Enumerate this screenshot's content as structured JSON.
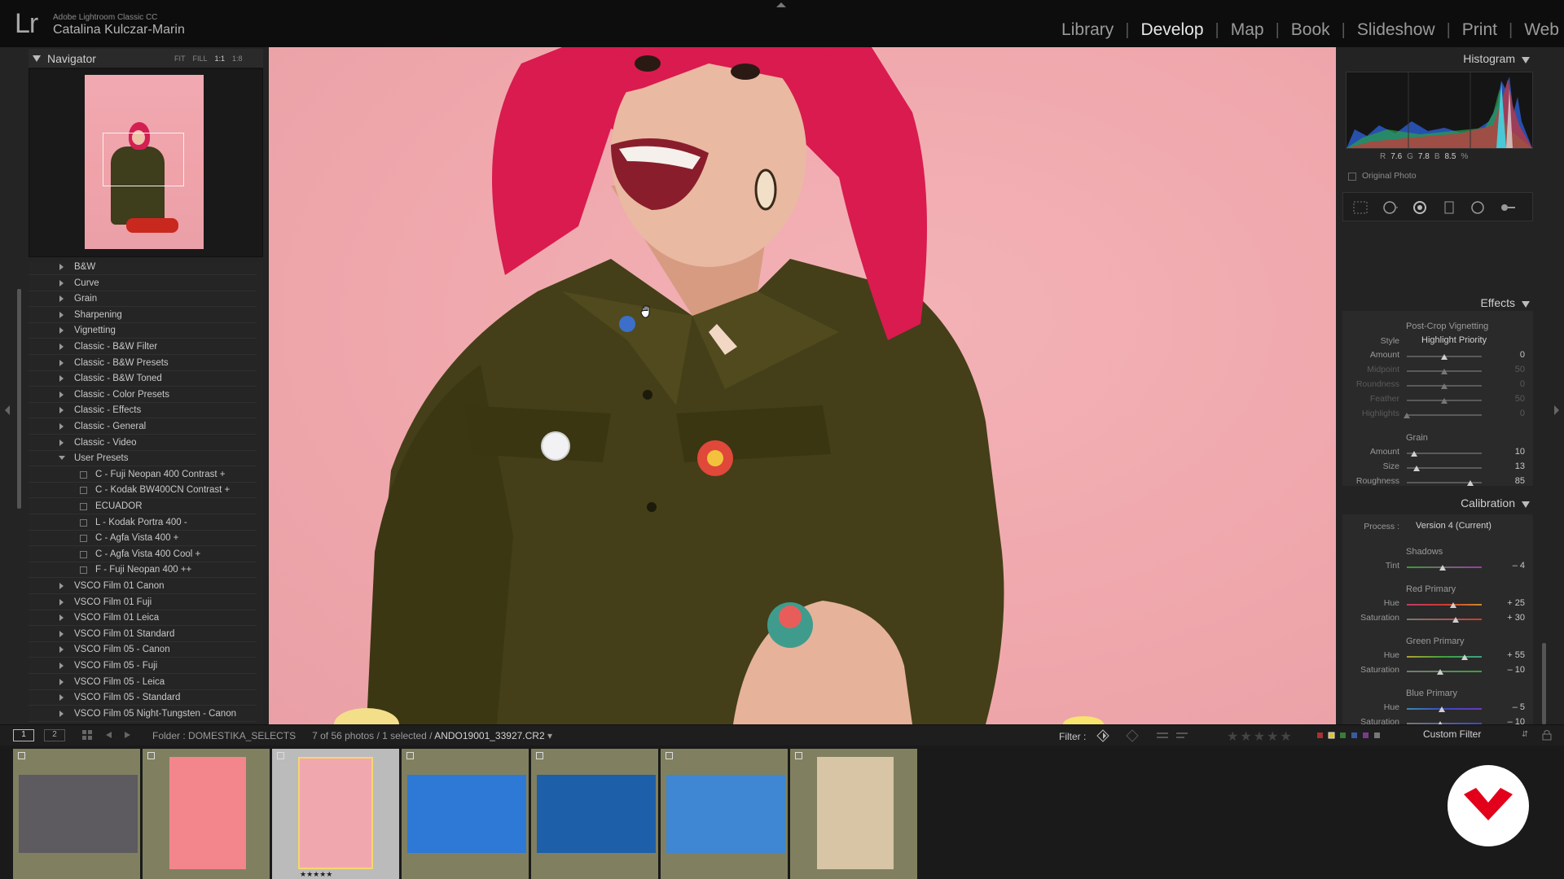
{
  "app": {
    "logo": "Lr",
    "name": "Adobe Lightroom Classic CC",
    "user": "Catalina Kulczar-Marin"
  },
  "modules": [
    {
      "label": "Library",
      "active": false
    },
    {
      "label": "Develop",
      "active": true
    },
    {
      "label": "Map",
      "active": false
    },
    {
      "label": "Book",
      "active": false
    },
    {
      "label": "Slideshow",
      "active": false
    },
    {
      "label": "Print",
      "active": false
    },
    {
      "label": "Web",
      "active": false
    }
  ],
  "navigator": {
    "title": "Navigator",
    "zoom_options": [
      "FIT",
      "FILL",
      "1:1",
      "1:8"
    ]
  },
  "presets": [
    {
      "label": "B&W",
      "type": "folder",
      "open": false
    },
    {
      "label": "Curve",
      "type": "folder",
      "open": false
    },
    {
      "label": "Grain",
      "type": "folder",
      "open": false
    },
    {
      "label": "Sharpening",
      "type": "folder",
      "open": false
    },
    {
      "label": "Vignetting",
      "type": "folder",
      "open": false
    },
    {
      "label": "Classic - B&W Filter",
      "type": "folder",
      "open": false
    },
    {
      "label": "Classic - B&W Presets",
      "type": "folder",
      "open": false
    },
    {
      "label": "Classic - B&W Toned",
      "type": "folder",
      "open": false
    },
    {
      "label": "Classic - Color Presets",
      "type": "folder",
      "open": false
    },
    {
      "label": "Classic - Effects",
      "type": "folder",
      "open": false
    },
    {
      "label": "Classic - General",
      "type": "folder",
      "open": false
    },
    {
      "label": "Classic - Video",
      "type": "folder",
      "open": false
    },
    {
      "label": "User Presets",
      "type": "folder",
      "open": true
    },
    {
      "label": "C - Fuji Neopan 400 Contrast +",
      "type": "preset"
    },
    {
      "label": "C - Kodak BW400CN Contrast +",
      "type": "preset"
    },
    {
      "label": "ECUADOR",
      "type": "preset"
    },
    {
      "label": "L - Kodak Portra 400 -",
      "type": "preset"
    },
    {
      "label": "C - Agfa Vista 400 +",
      "type": "preset"
    },
    {
      "label": "C - Agfa Vista 400 Cool +",
      "type": "preset"
    },
    {
      "label": "F - Fuji Neopan 400 ++",
      "type": "preset"
    },
    {
      "label": "VSCO Film 01 Canon",
      "type": "folder",
      "open": false
    },
    {
      "label": "VSCO Film 01 Fuji",
      "type": "folder",
      "open": false
    },
    {
      "label": "VSCO Film 01 Leica",
      "type": "folder",
      "open": false
    },
    {
      "label": "VSCO Film 01 Standard",
      "type": "folder",
      "open": false
    },
    {
      "label": "VSCO Film 05 - Canon",
      "type": "folder",
      "open": false
    },
    {
      "label": "VSCO Film 05 - Fuji",
      "type": "folder",
      "open": false
    },
    {
      "label": "VSCO Film 05 - Leica",
      "type": "folder",
      "open": false
    },
    {
      "label": "VSCO Film 05 - Standard",
      "type": "folder",
      "open": false
    },
    {
      "label": "VSCO Film 05 Night-Tungsten - Canon",
      "type": "folder",
      "open": false
    }
  ],
  "histogram": {
    "title": "Histogram",
    "r_label": "R",
    "r_value": "7.6",
    "g_label": "G",
    "g_value": "7.8",
    "b_label": "B",
    "b_value": "8.5",
    "unit": "%",
    "original_photo_label": "Original Photo"
  },
  "effects": {
    "title": "Effects",
    "vignette_title": "Post-Crop Vignetting",
    "style_label": "Style",
    "style_value": "Highlight Priority",
    "sliders": [
      {
        "label": "Amount",
        "value": "0",
        "pos": 0.5,
        "dim": false
      },
      {
        "label": "Midpoint",
        "value": "50",
        "pos": 0.5,
        "dim": true
      },
      {
        "label": "Roundness",
        "value": "0",
        "pos": 0.5,
        "dim": true
      },
      {
        "label": "Feather",
        "value": "50",
        "pos": 0.5,
        "dim": true
      },
      {
        "label": "Highlights",
        "value": "0",
        "pos": 0.0,
        "dim": true
      }
    ],
    "grain_title": "Grain",
    "grain_sliders": [
      {
        "label": "Amount",
        "value": "10",
        "pos": 0.1,
        "dim": false
      },
      {
        "label": "Size",
        "value": "13",
        "pos": 0.13,
        "dim": false
      },
      {
        "label": "Roughness",
        "value": "85",
        "pos": 0.85,
        "dim": false
      }
    ]
  },
  "calibration": {
    "title": "Calibration",
    "process_label": "Process :",
    "process_value": "Version 4 (Current)",
    "groups": [
      {
        "title": "Shadows",
        "sliders": [
          {
            "label": "Tint",
            "value": "– 4",
            "pos": 0.48,
            "track": "tint"
          }
        ]
      },
      {
        "title": "Red Primary",
        "sliders": [
          {
            "label": "Hue",
            "value": "+ 25",
            "pos": 0.62,
            "track": "red-hue"
          },
          {
            "label": "Saturation",
            "value": "+ 30",
            "pos": 0.65,
            "track": "red-sat"
          }
        ]
      },
      {
        "title": "Green Primary",
        "sliders": [
          {
            "label": "Hue",
            "value": "+ 55",
            "pos": 0.77,
            "track": "green-hue"
          },
          {
            "label": "Saturation",
            "value": "– 10",
            "pos": 0.45,
            "track": "green-sat"
          }
        ]
      },
      {
        "title": "Blue Primary",
        "sliders": [
          {
            "label": "Hue",
            "value": "– 5",
            "pos": 0.47,
            "track": "blue-hue"
          },
          {
            "label": "Saturation",
            "value": "– 10",
            "pos": 0.45,
            "track": "blue-sat"
          }
        ]
      }
    ]
  },
  "filmstrip_bar": {
    "page1": "1",
    "page2": "2",
    "folder_label": "Folder :",
    "folder_name": "DOMESTIKA_SELECTS",
    "count": "7 of 56 photos / 1 selected /",
    "filename": "ANDO19001_33927.CR2",
    "filter_label": "Filter :",
    "custom_filter": "Custom Filter"
  },
  "filmstrip": {
    "thumbs": [
      {
        "bg": "#5d5b5f",
        "selected": false,
        "stars": ""
      },
      {
        "bg": "#f2868c",
        "selected": false,
        "stars": ""
      },
      {
        "bg": "#f0a8ae",
        "selected": true,
        "stars": "★★★★★"
      },
      {
        "bg": "#2e79d5",
        "selected": false,
        "stars": ""
      },
      {
        "bg": "#1d5fa9",
        "selected": false,
        "stars": ""
      },
      {
        "bg": "#3f86d3",
        "selected": false,
        "stars": ""
      },
      {
        "bg": "#d7c5a6",
        "selected": false,
        "stars": ""
      }
    ]
  },
  "colors": {
    "accent": "#e8e8e8",
    "panel": "#242424",
    "topbar": "#0d0d0d",
    "film_cell": "#808060",
    "brand_red": "#e3001b"
  }
}
